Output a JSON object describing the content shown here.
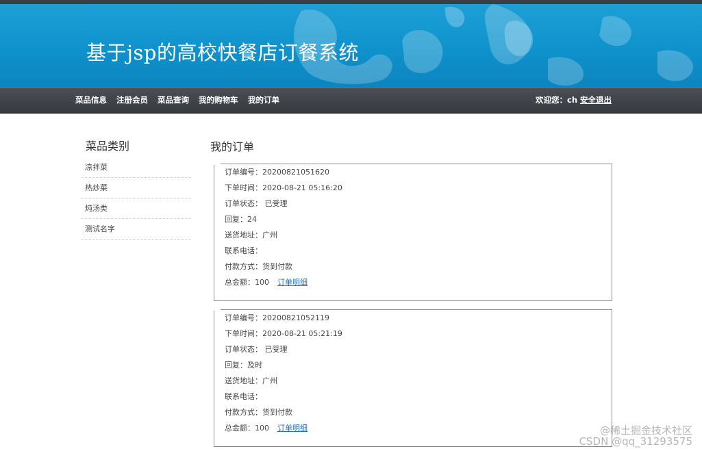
{
  "header": {
    "title": "基于jsp的高校快餐店订餐系统"
  },
  "nav": {
    "items": [
      {
        "label": "菜品信息"
      },
      {
        "label": "注册会员"
      },
      {
        "label": "菜品查询"
      },
      {
        "label": "我的购物车"
      },
      {
        "label": "我的订单"
      }
    ],
    "welcome": "欢迎您：ch",
    "logout": "安全退出"
  },
  "sidebar": {
    "title": "菜品类别",
    "categories": [
      "凉拌菜",
      "热炒菜",
      "炖汤类",
      "测试名字"
    ]
  },
  "main": {
    "title": "我的订单",
    "orders": [
      {
        "order_no": "订单编号：20200821051620",
        "order_time": "下单时间：2020-08-21 05:16:20",
        "status": "订单状态： 已受理",
        "reply": "回复：24",
        "address": "送货地址：广州",
        "phone": "联系电话：",
        "payment": "付款方式：货到付款",
        "total": "总金额：100",
        "detail_link": "订单明细"
      },
      {
        "order_no": "订单编号：20200821052119",
        "order_time": "下单时间：2020-08-21 05:21:19",
        "status": "订单状态： 已受理",
        "reply": "回复：及时",
        "address": "送货地址：广州",
        "phone": "联系电话：",
        "payment": "付款方式：货到付款",
        "total": "总金额：100",
        "detail_link": "订单明细"
      }
    ]
  },
  "watermark": {
    "line1": "@稀土掘金技术社区",
    "line2": "CSDN @qq_31293575"
  },
  "colors": {
    "banner": "#1098d1",
    "navbar": "#3f444a",
    "link": "#1a73b8"
  }
}
